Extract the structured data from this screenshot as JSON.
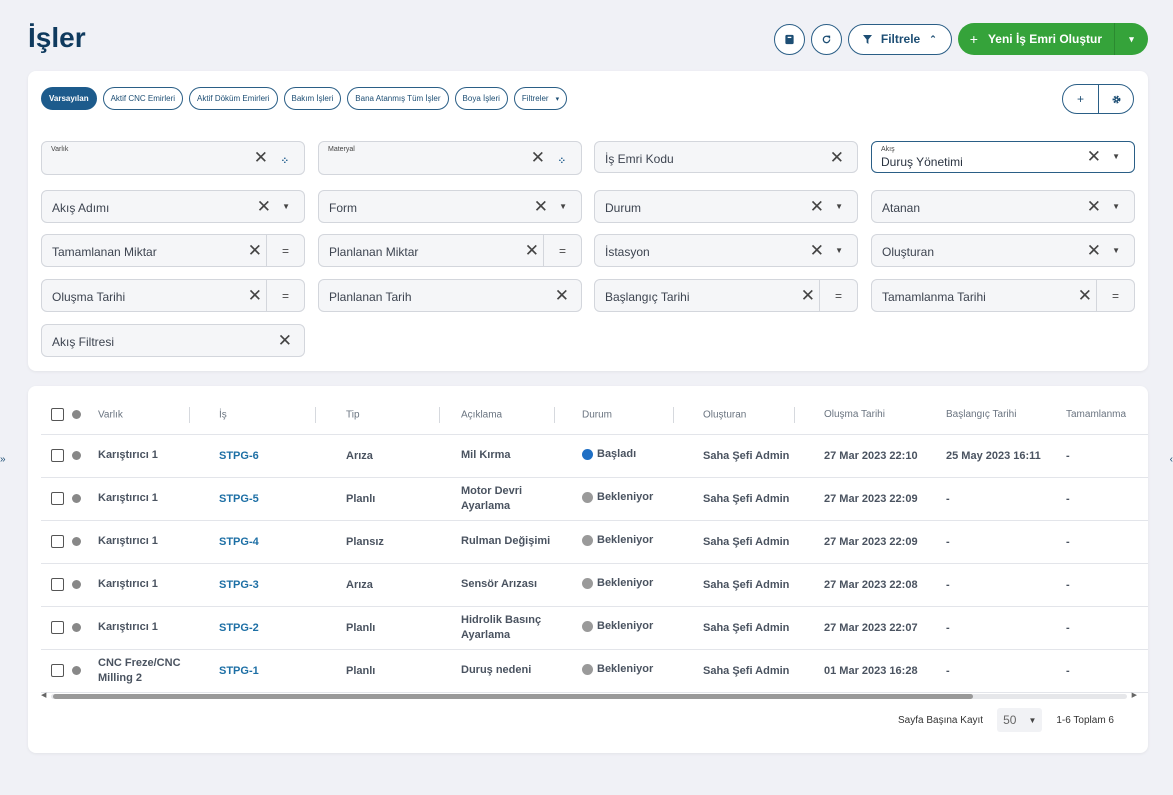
{
  "page": {
    "title": "İşler"
  },
  "top_actions": {
    "filter_label": "Filtrele",
    "new_label": "Yeni İş Emri Oluştur"
  },
  "chips": [
    "Varsayılan",
    "Aktif CNC Emirleri",
    "Aktif Döküm Emirleri",
    "Bakım İşleri",
    "Bana Atanmış Tüm İşler",
    "Boya İşleri",
    "Filtreler"
  ],
  "filters": {
    "varlik": "Varlık",
    "materyal": "Materyal",
    "is_emri_kodu": "İş Emri Kodu",
    "akis_label": "Akış",
    "akis_value": "Duruş Yönetimi",
    "akis_adimi": "Akış Adımı",
    "form": "Form",
    "durum": "Durum",
    "atanan": "Atanan",
    "tamamlanan_miktar": "Tamamlanan Miktar",
    "planlanan_miktar": "Planlanan Miktar",
    "istasyon": "İstasyon",
    "olusturan": "Oluşturan",
    "olusma_tarihi": "Oluşma Tarihi",
    "planlanan_tarih": "Planlanan Tarih",
    "baslangic_tarihi": "Başlangıç Tarihi",
    "tamamlanma_tarihi": "Tamamlanma Tarihi",
    "akis_filtresi": "Akış Filtresi",
    "eq": "="
  },
  "table": {
    "columns": [
      "Varlık",
      "İş",
      "Tip",
      "Açıklama",
      "Durum",
      "Oluşturan",
      "Oluşma Tarihi",
      "Başlangıç Tarihi",
      "Tamamlanma"
    ],
    "rows": [
      [
        "Karıştırıcı 1",
        "STPG-6",
        "Arıza",
        "Mil Kırma",
        "Başladı",
        "Saha Şefi Admin",
        "27 Mar 2023 22:10",
        "25 May 2023 16:11",
        "-"
      ],
      [
        "Karıştırıcı 1",
        "STPG-5",
        "Planlı",
        "Motor Devri Ayarlama",
        "Bekleniyor",
        "Saha Şefi Admin",
        "27 Mar 2023 22:09",
        "-",
        "-"
      ],
      [
        "Karıştırıcı 1",
        "STPG-4",
        "Plansız",
        "Rulman Değişimi",
        "Bekleniyor",
        "Saha Şefi Admin",
        "27 Mar 2023 22:09",
        "-",
        "-"
      ],
      [
        "Karıştırıcı 1",
        "STPG-3",
        "Arıza",
        "Sensör Arızası",
        "Bekleniyor",
        "Saha Şefi Admin",
        "27 Mar 2023 22:08",
        "-",
        "-"
      ],
      [
        "Karıştırıcı 1",
        "STPG-2",
        "Planlı",
        "Hidrolik Basınç Ayarlama",
        "Bekleniyor",
        "Saha Şefi Admin",
        "27 Mar 2023 22:07",
        "-",
        "-"
      ],
      [
        "CNC Freze/CNC Milling 2",
        "STPG-1",
        "Planlı",
        "Duruş nedeni",
        "Bekleniyor",
        "Saha Şefi Admin",
        "01 Mar 2023 16:28",
        "-",
        "-"
      ]
    ]
  },
  "status_colors": {
    "Başladı": "#1f6fc4",
    "Bekleniyor": "#9a9a9a"
  },
  "pager": {
    "label": "Sayfa Başına Kayıt",
    "per_page": "50",
    "summary": "1-6 Toplam 6"
  },
  "edges": {
    "left": "»",
    "right": "‹"
  }
}
